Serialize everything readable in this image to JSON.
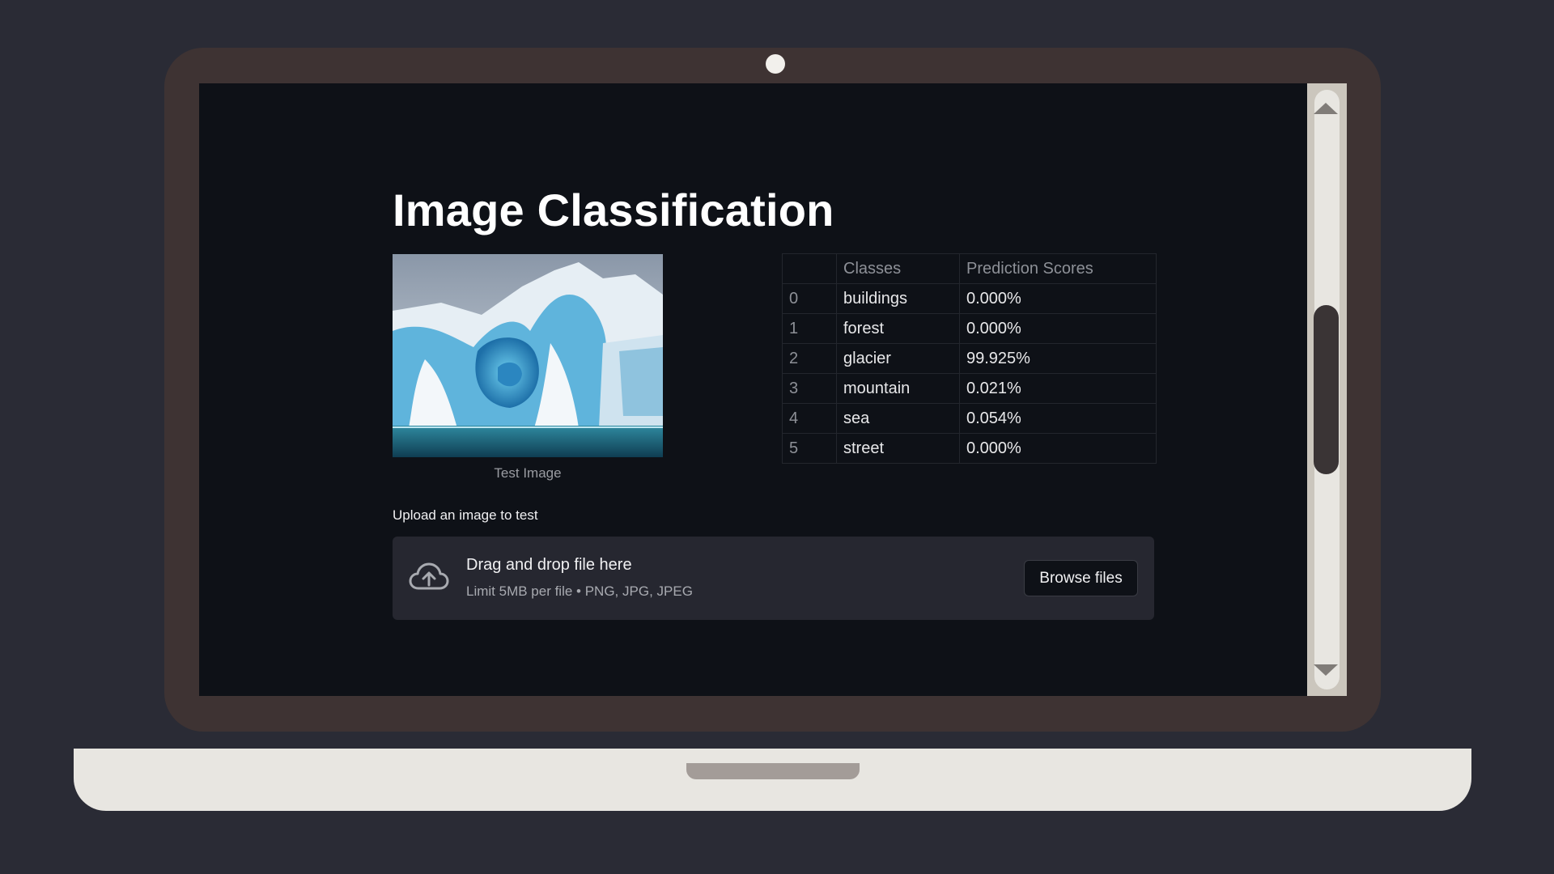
{
  "app": {
    "title": "Image Classification"
  },
  "test_image": {
    "caption": "Test Image"
  },
  "results_table": {
    "headers": [
      "",
      "Classes",
      "Prediction Scores"
    ],
    "rows": [
      {
        "index": "0",
        "class": "buildings",
        "score": "0.000%"
      },
      {
        "index": "1",
        "class": "forest",
        "score": "0.000%"
      },
      {
        "index": "2",
        "class": "glacier",
        "score": "99.925%"
      },
      {
        "index": "3",
        "class": "mountain",
        "score": "0.021%"
      },
      {
        "index": "4",
        "class": "sea",
        "score": "0.054%"
      },
      {
        "index": "5",
        "class": "street",
        "score": "0.000%"
      }
    ]
  },
  "uploader": {
    "label": "Upload an image to test",
    "drop_title": "Drag and drop file here",
    "limit_text": "Limit 5MB per file • PNG, JPG, JPEG",
    "browse_label": "Browse files",
    "icon": "cloud-upload-icon"
  },
  "colors": {
    "background": "#0e1117",
    "dropzone": "#262730",
    "text": "#ffffff"
  }
}
